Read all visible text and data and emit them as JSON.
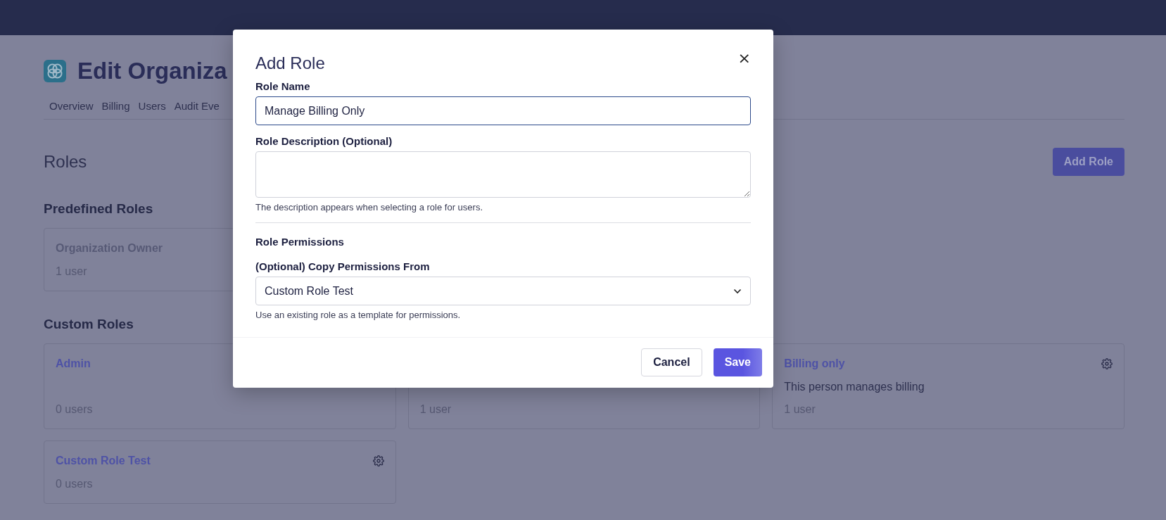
{
  "page": {
    "title": "Edit Organiza",
    "tabs": [
      {
        "label": "Overview"
      },
      {
        "label": "Billing"
      },
      {
        "label": "Users"
      },
      {
        "label": "Audit Eve"
      }
    ],
    "section_title": "Roles",
    "add_button": "Add Role"
  },
  "predefined_roles": {
    "heading": "Predefined Roles",
    "cards": [
      {
        "title": "Organization Owner",
        "count": "1 user"
      }
    ]
  },
  "custom_roles": {
    "heading": "Custom Roles",
    "cards": [
      {
        "title": "Admin",
        "count": "0 users"
      },
      {
        "count": "1 user"
      },
      {
        "title": "Billing only",
        "description": "This person manages billing",
        "count": "1 user",
        "settings": true
      },
      {
        "title": "Custom Role Test",
        "count": "0 users",
        "settings": true
      }
    ]
  },
  "modal": {
    "title": "Add Role",
    "close": "×",
    "role_name": {
      "label": "Role Name",
      "value": "Manage Billing Only"
    },
    "role_description": {
      "label": "Role Description (Optional)",
      "help": "The description appears when selecting a role for users."
    },
    "permissions_heading": "Role Permissions",
    "copy_from": {
      "label": "(Optional) Copy Permissions From",
      "value": "Custom Role Test",
      "help": "Use an existing role as a template for permissions."
    },
    "buttons": [
      {
        "label": "Cancel",
        "kind": "secondary"
      },
      {
        "label": "Save",
        "kind": "primary"
      }
    ]
  }
}
